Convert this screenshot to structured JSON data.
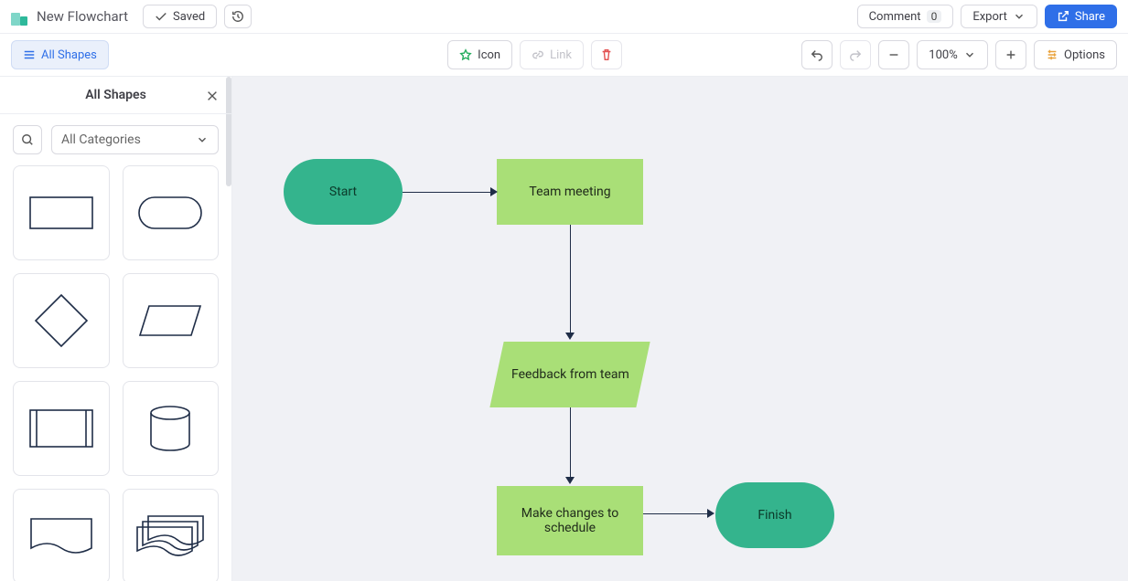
{
  "header": {
    "doc_title": "New Flowchart",
    "saved_label": "Saved",
    "comment_label": "Comment",
    "comment_count": "0",
    "export_label": "Export",
    "share_label": "Share"
  },
  "toolbar": {
    "all_shapes_label": "All Shapes",
    "icon_btn_label": "Icon",
    "link_btn_label": "Link",
    "zoom_level": "100%",
    "options_label": "Options"
  },
  "sidebar": {
    "title": "All Shapes",
    "category_dropdown": "All Categories"
  },
  "flow": {
    "start": "Start",
    "meeting": "Team meeting",
    "feedback": "Feedback from team",
    "changes": "Make changes to schedule",
    "finish": "Finish"
  }
}
